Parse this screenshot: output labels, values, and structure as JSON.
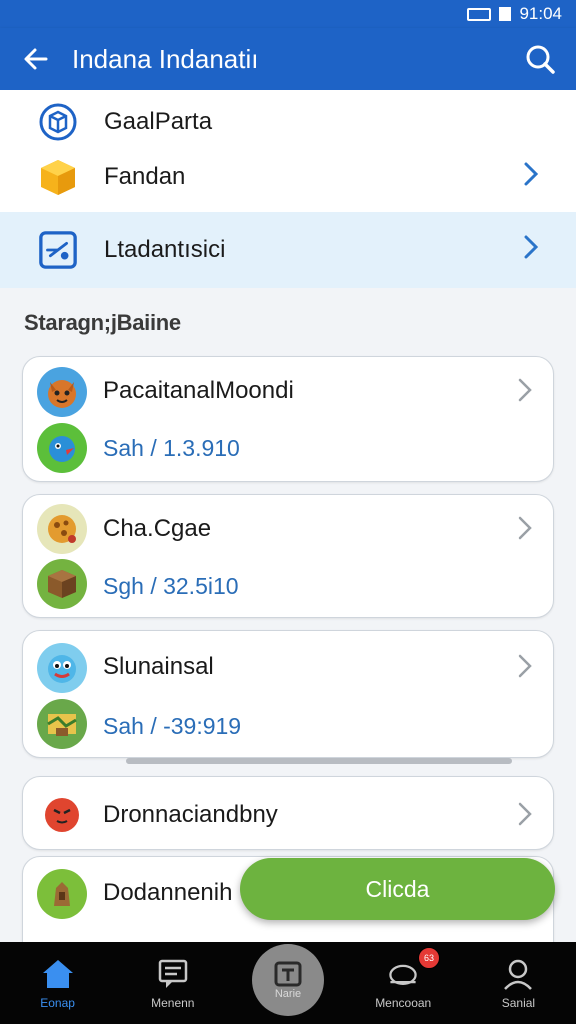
{
  "status": {
    "time": "91:04"
  },
  "appbar": {
    "title": "Indana Indanatiı"
  },
  "top_list": [
    {
      "label": "GaalParta",
      "icon": "cube-outline-icon",
      "has_chevron": false
    },
    {
      "label": "Fandan",
      "icon": "yellow-cube-icon",
      "has_chevron": true
    },
    {
      "label": "Ltadantısici",
      "icon": "blue-edit-box-icon",
      "has_chevron": true,
      "highlighted": true
    }
  ],
  "section": {
    "title": "Staragn;jBaiine"
  },
  "cards": [
    {
      "name": "PacaitanalMoondi",
      "sub": "Sah / 1.3.910",
      "icon_top": "fox-app-icon",
      "icon_bottom": "green-bird-app-icon"
    },
    {
      "name": "Cha.Cgae",
      "sub": "Sgh / 32.5i10",
      "icon_top": "cookie-app-icon",
      "icon_bottom": "block-app-icon"
    },
    {
      "name": "Slunainsal",
      "sub": "Sah / -39:919",
      "icon_top": "blue-monster-app-icon",
      "icon_bottom": "map-app-icon"
    },
    {
      "name": "Dronnaciandbny",
      "sub": "",
      "icon_top": "red-bird-app-icon",
      "icon_bottom": ""
    },
    {
      "name": "Dodannenih",
      "sub": "",
      "icon_top": "tower-app-icon",
      "icon_bottom": ""
    }
  ],
  "fab": {
    "label": "Clicda"
  },
  "bottom_nav": [
    {
      "label": "Eonap",
      "icon": "home-icon",
      "active": true
    },
    {
      "label": "Menenn",
      "icon": "message-icon",
      "active": false
    },
    {
      "label": "Narie",
      "icon": "center-tab-icon",
      "active": false
    },
    {
      "label": "Mencooan",
      "icon": "bell-icon",
      "active": false,
      "badge": "63"
    },
    {
      "label": "Sanial",
      "icon": "profile-icon",
      "active": false
    }
  ],
  "colors": {
    "primary": "#1e63c6",
    "accent_green": "#6db33f",
    "link_blue": "#2a6db7",
    "highlight": "#e3f1fb"
  }
}
